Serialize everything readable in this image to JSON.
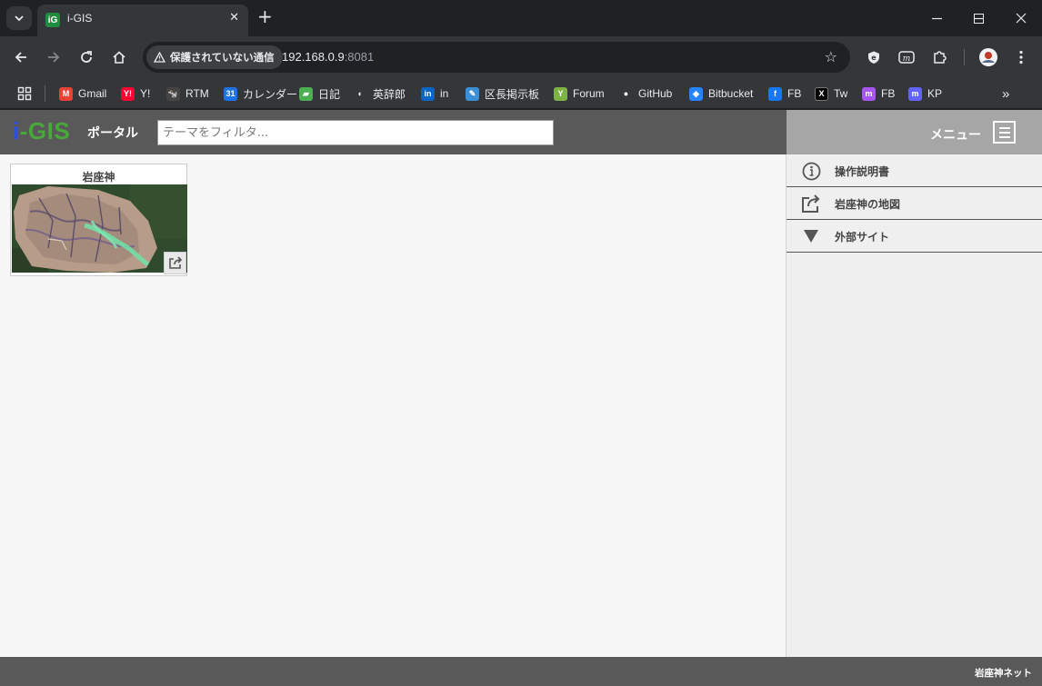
{
  "browser": {
    "tab_title": "i-GIS",
    "tab_favicon_text": "iG",
    "security_label": "保護されていない通信",
    "url_host": "192.168.0.9",
    "url_port": ":8081"
  },
  "bookmarks": [
    {
      "label": "Gmail",
      "icon": "gmail-icon",
      "color": "#ea4335",
      "glyph": "M"
    },
    {
      "label": "Y!",
      "icon": "yahoo-icon",
      "color": "#ff0033",
      "glyph": "Y!"
    },
    {
      "label": "RTM",
      "icon": "rtm-cow-icon",
      "color": "#444444",
      "glyph": "🐄"
    },
    {
      "label": "カレンダー",
      "icon": "calendar-icon",
      "color": "#1a73e8",
      "glyph": "31"
    },
    {
      "label": "日記",
      "icon": "notebook-icon",
      "color": "#4caf50",
      "glyph": "▰"
    },
    {
      "label": "英辞郎",
      "icon": "eijiro-icon",
      "color": "#ffffff",
      "glyph": "◐"
    },
    {
      "label": "in",
      "icon": "linkedin-icon",
      "color": "#0a66c2",
      "glyph": "in"
    },
    {
      "label": "区長掲示板",
      "icon": "board-icon",
      "color": "#3b8fd6",
      "glyph": "✎"
    },
    {
      "label": "Forum",
      "icon": "forum-icon",
      "color": "#7cb342",
      "glyph": "Y"
    },
    {
      "label": "GitHub",
      "icon": "github-icon",
      "color": "#ffffff",
      "glyph": "●"
    },
    {
      "label": "Bitbucket",
      "icon": "bitbucket-icon",
      "color": "#2684ff",
      "glyph": "◆"
    },
    {
      "label": "FB",
      "icon": "facebook-icon",
      "color": "#1877f2",
      "glyph": "f"
    },
    {
      "label": "Tw",
      "icon": "x-icon",
      "color": "#000000",
      "glyph": "X"
    },
    {
      "label": "FB",
      "icon": "mastodon-icon",
      "color": "#a855f7",
      "glyph": "m"
    },
    {
      "label": "KP",
      "icon": "mastodon-icon",
      "color": "#6364ff",
      "glyph": "m"
    }
  ],
  "app": {
    "logo_i": "i",
    "logo_rest": "-GIS",
    "portal_label": "ポータル",
    "filter_placeholder": "テーマをフィルタ...",
    "menu_label": "メニュー",
    "menu_items": [
      {
        "label": "操作説明書",
        "icon": "info-icon"
      },
      {
        "label": "岩座神の地図",
        "icon": "share-icon"
      },
      {
        "label": "外部サイト",
        "icon": "triangle-down-icon"
      }
    ],
    "card": {
      "title": "岩座神"
    },
    "footer_text": "岩座神ネット"
  }
}
